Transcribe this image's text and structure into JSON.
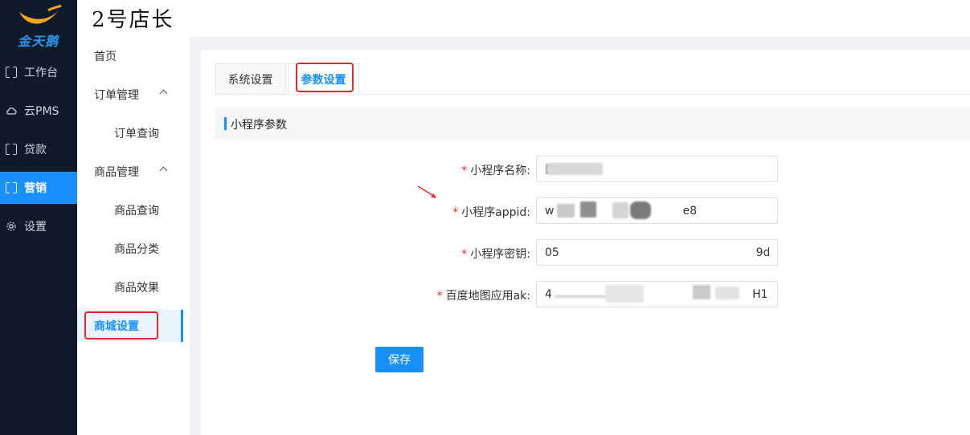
{
  "app": {
    "logo_text": "金天鹅",
    "store_title": "2号店长"
  },
  "colors": {
    "rail_bg": "#0f1a2b",
    "accent": "#1890ff",
    "highlight": "#e8262a",
    "required": "#f5222d"
  },
  "rail": {
    "items": [
      {
        "label": "工作台",
        "icon": "bracket-icon"
      },
      {
        "label": "云PMS",
        "icon": "cloud-icon"
      },
      {
        "label": "贷款",
        "icon": "bracket-icon"
      },
      {
        "label": "营销",
        "icon": "bracket-icon",
        "active": true
      },
      {
        "label": "设置",
        "icon": "gear-icon"
      }
    ]
  },
  "subnav": {
    "items": [
      {
        "label": "首页"
      },
      {
        "label": "订单管理",
        "expanded": true
      },
      {
        "label": "订单查询"
      },
      {
        "label": "商品管理",
        "expanded": true
      },
      {
        "label": "商品查询"
      },
      {
        "label": "商品分类"
      },
      {
        "label": "商品效果"
      },
      {
        "label": "商城设置",
        "active": true
      }
    ]
  },
  "tabs": [
    {
      "label": "系统设置"
    },
    {
      "label": "参数设置",
      "active": true
    }
  ],
  "section_title": "小程序参数",
  "form": {
    "fields": [
      {
        "label": "小程序名称:",
        "value": "戬",
        "required": true
      },
      {
        "label": "小程序appid:",
        "value": "w                                    e8",
        "required": true
      },
      {
        "label": "小程序密钥:",
        "value": "05                                                       9d",
        "required": true
      },
      {
        "label": "百度地图应用ak:",
        "value": "4                                                        H1",
        "required": true
      }
    ],
    "required_mark": "*"
  },
  "save_label": "保存"
}
